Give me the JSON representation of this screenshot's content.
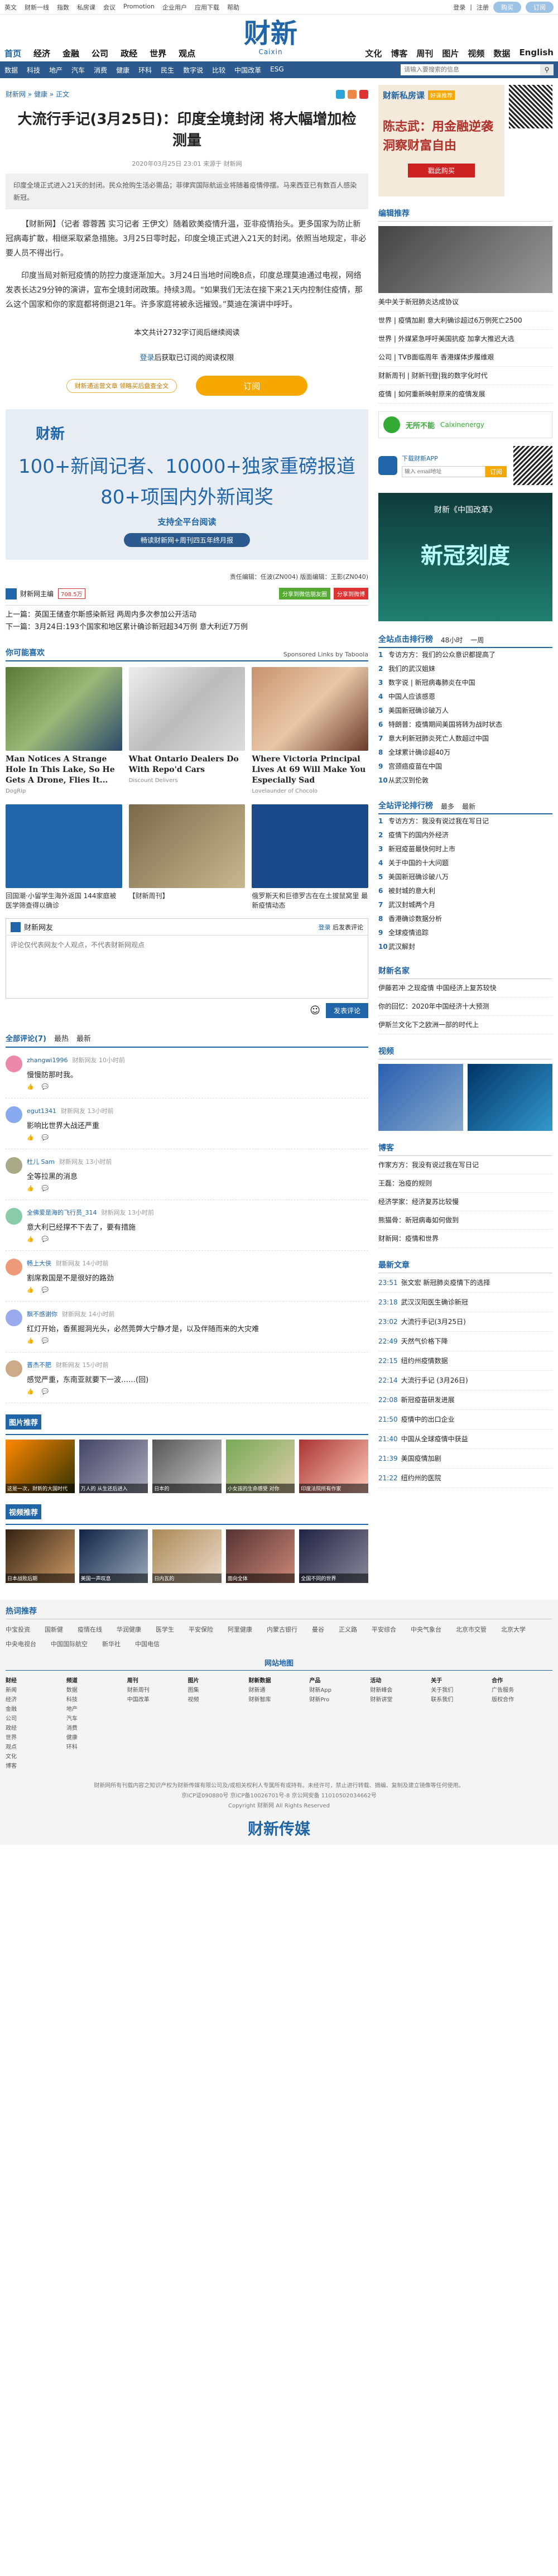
{
  "topbar": {
    "links": [
      "英文",
      "财新一线",
      "指数",
      "私房课",
      "会议",
      "Promotion",
      "企业用户",
      "应用下载",
      "帮助"
    ],
    "login": "登录",
    "register": "注册",
    "pill1": "购买",
    "pill2": "订阅"
  },
  "header": {
    "nav_left": [
      "首页",
      "经济",
      "金融",
      "公司",
      "政经",
      "世界",
      "观点"
    ],
    "logo_zh": "财新",
    "logo_en": "Caixin",
    "nav_right": [
      "文化",
      "博客",
      "周刊",
      "图片",
      "视频",
      "数据",
      "English"
    ]
  },
  "subnav": {
    "items": [
      "数据",
      "科技",
      "地产",
      "汽车",
      "消费",
      "健康",
      "环科",
      "民生",
      "数字说",
      "比较",
      "中国改革",
      "ESG"
    ],
    "search_placeholder": "请输入要搜索的信息"
  },
  "crumb": [
    "财新网",
    "健康",
    "正文"
  ],
  "article": {
    "title": "大流行手记(3月25日)：印度全境封闭 将大幅增加检测量",
    "meta": "2020年03月25日 23:01 来源于 财新网",
    "abstract": "印度全境正式进入21天的封闭。民众抢购生活必需品；菲律宾国际航运业将随着疫情停摆。马来西亚已有数百人感染新冠。",
    "p1": "【财新网】（记者 蓉蓉茜 实习记者 王伊文）随着欧美疫情升温，亚非疫情抬头。更多国家为防止新冠病毒扩散，相继采取紧急措施。3月25日零时起，印度全境正式进入21天的封闭。依照当地规定，非必要人员不得出行。",
    "p2": "印度当局对新冠疫情的防控力度逐渐加大。3月24日当地时间晚8点，印度总理莫迪通过电视，网络发表长达29分钟的演讲，宣布全境封闭政策。持续3周。“如果我们无法在接下来21天内控制住疫情，那么这个国家和你的家庭都将倒退21年。许多家庭将被永远摧毁。”莫迪在演讲中呼吁。",
    "count": "本文共计2732字订阅后继续阅读",
    "login_prefix": "登录",
    "login_suffix": "后获取已订阅的阅读权限",
    "pay_badge": "财新通运营文章 领略买后盘查全文",
    "pay_btn": "订阅",
    "promo": {
      "logo": "财新",
      "l1": "100+新闻记者、10000+独家重磅报道",
      "l2": "80+项国内外新闻奖",
      "l3": "支持全平台阅读",
      "l4": "畅读财新网+周刊四五年终月报"
    },
    "editors": "责任编辑：任波(ZN004) 版面编辑：王影(ZN040)",
    "tool_label": "财新网主编",
    "tool_chip": "708.5万",
    "rbtn1": "分享到微信朋友圈",
    "rbtn2": "分享到微博",
    "prev": "上一篇：英国王储查尔斯感染新冠 两周内多次参加公开活动",
    "next": "下一篇：3月24日:193个国家和地区累计确诊新冠超34万例 意大利近7万例"
  },
  "maybe": {
    "title": "你可能喜欢",
    "sponsor": "Sponsored Links by Taboola",
    "cards": [
      {
        "title": "Man Notices A Strange Hole In This Lake, So He Gets A Drone, Flies It...",
        "src": "DogRip"
      },
      {
        "title": "What Ontario Dealers Do With Repo'd Cars",
        "src": "Discount Delivers"
      },
      {
        "title": "Where Victoria Principal Lives At 69 Will Make You Especially Sad",
        "src": "Lovelaunder of Chocolo"
      }
    ],
    "cards2": [
      {
        "cap": "回国潮·小留学生海外返国 144家庭被医学筛查得以确诊"
      },
      {
        "cap": "【财新周刊】"
      },
      {
        "cap": "俄罗斯天和巨德罗古在在土拔鼠窝里 最新疫情动态"
      }
    ]
  },
  "comment": {
    "head": "财新网友",
    "login": "登录",
    "login2": "后发表评论",
    "placeholder": "评论仅代表网友个人观点，不代表财新网观点",
    "send": "发表评论",
    "tabs": [
      "全部评论(7)",
      "最热",
      "最新"
    ],
    "items": [
      {
        "user": "zhangwi1996",
        "time": "财新网友  10小时前",
        "text": "慢慢防那时我。"
      },
      {
        "user": "egut1341",
        "time": "财新网友  13小时前",
        "text": "影响比世界大战还严重"
      },
      {
        "user": "杜儿 Sam",
        "time": "财新网友  13小时前",
        "text": "全等拉黑的消息"
      },
      {
        "user": "全佛爱是海的飞行员_314",
        "time": "财新网友  13小时前",
        "text": "意大利已经撑不下去了，要有措施"
      },
      {
        "user": "畅上大侠",
        "time": "财新网友  14小时前",
        "text": "割席救国是不是很好的路劲"
      },
      {
        "user": "飘不感谢你",
        "time": "财新网友  14小时前",
        "text": "红灯开始，香蕉掘洞光头，必然莞弊大宁静才是，以及伴随而来的大灾难"
      },
      {
        "user": "晋杰不肥",
        "time": "财新网友  15小时前",
        "text": "感觉严重，东南亚就要下一波……(回)"
      }
    ]
  },
  "pics": {
    "title": "图片推荐",
    "items": [
      "这是一次，财新的大国时代",
      "万人的 从生还后进入",
      "日本的",
      "小女孩的生命感受 对你",
      "印度法院所有作家"
    ]
  },
  "videos": {
    "title": "视频推荐",
    "items": [
      "日本战败后期",
      "美国一声叹息",
      "日内瓦的",
      "面向全体",
      "全国不同的世界"
    ]
  },
  "side": {
    "ad1_title": "财新私房课",
    "ad1_btn": "好课推荐",
    "ad1_big": "陈志武：用金融逆袭洞察财富自由",
    "ad1_cta": "戳此购买",
    "hot_title": "编辑推荐",
    "hot_items": [
      "美中关于新冠肺炎达成协议",
      "世界 | 疫情加剧 意大利确诊超过6万例死亡2500",
      "世界 | 外媒紧急呼吁美国抗疫 加拿大推迟大选",
      "公司 | TVB面临周年 香港媒体步履维艰",
      "财新周刊 | 财新刊登|我的数字化时代",
      "疫情 | 如何重新映射原来的疫情发展"
    ],
    "reg_label": "无所不能",
    "reg_brand": "Caixinenergy",
    "app_label": "下载财新APP",
    "email_label": "输入 email地址",
    "email_btn": "订阅",
    "ad2_title": "财新《中国改革》",
    "ad2_big": "新冠刻度",
    "rank_title": "全站点击排行榜",
    "rank_tabs": [
      "48小时",
      "一周"
    ],
    "rank": [
      "专访方方：我们的公众意识都提高了",
      "我们的武汉姐妹",
      "数字说 | 新冠病毒肺炎在中国",
      "中国人应该感恩",
      "美国新冠确诊破万人",
      "特朗普：疫情期间美国将转为战时状态",
      "意大利新冠肺炎死亡人数超过中国",
      "全球累计确诊超40万",
      "宫颈癌疫苗在中国",
      "从武汉到伦敦"
    ],
    "cmt_title": "全站评论排行榜",
    "cmt_tabs": [
      "最多",
      "最新"
    ],
    "cmtrank": [
      "专访方方：我没有说过我在写日记",
      "疫情下的国内外经济",
      "新冠疫苗最快何时上市",
      "关于中国的十大问题",
      "美国新冠确诊破八万",
      "被封城的意大利",
      "武汉封城两个月",
      "香港确诊数据分析",
      "全球疫情追踪",
      "武汉解封"
    ],
    "caixin_title": "财新名家",
    "caixin_items": [
      "伊藤若冲 之现疫情 中国经济上复苏较快",
      "你的回忆：2020年中国经济十大预测",
      "伊斯兰文化下之欧洲一部的时代上"
    ],
    "video_title": "视频",
    "blog_title": "博客",
    "blog_items": [
      "作家方方：我没有说过我在写日记",
      "王磊：治疫的规则",
      "经济学家：经济复苏比较慢",
      "熊猫骨：新冠病毒如何做到",
      "财新网：疫情和世界"
    ],
    "news_title": "最新文章",
    "news": [
      {
        "t": "23:51",
        "s": "张文宏 新冠肺炎疫情下的选择"
      },
      {
        "t": "23:18",
        "s": "武汉汉阳医生确诊新冠"
      },
      {
        "t": "23:02",
        "s": "大流行手记(3月25日)"
      },
      {
        "t": "22:49",
        "s": "天然气价格下降"
      },
      {
        "t": "22:15",
        "s": "纽约州疫情数据"
      },
      {
        "t": "22:14",
        "s": "大流行手记 (3月26日)"
      },
      {
        "t": "22:08",
        "s": "新冠疫苗研发进展"
      },
      {
        "t": "21:50",
        "s": "疫情中的出口企业"
      },
      {
        "t": "21:40",
        "s": "中国从全球疫情中获益"
      },
      {
        "t": "21:39",
        "s": "美国疫情加剧"
      },
      {
        "t": "21:22",
        "s": "纽约州的医院"
      }
    ]
  },
  "footer": {
    "hot_title": "热词推荐",
    "hot": [
      "中宝投资",
      "国新健",
      "疫情在线",
      "华润健康",
      "医学生",
      "平安保险",
      "阿里健康",
      "内蒙古银行",
      "曼谷",
      "正义路",
      "平安综合",
      "中央气象台",
      "北京市交管",
      "北京大学",
      "中央电视台",
      "中国国际航空",
      "新华社",
      "中国电信"
    ],
    "map_title": "网站地图",
    "cols": [
      {
        "h": "财经",
        "items": [
          "新闻",
          "经济",
          "金融",
          "公司",
          "政经",
          "世界",
          "观点",
          "文化",
          "博客"
        ]
      },
      {
        "h": "频道",
        "items": [
          "数据",
          "科技",
          "地产",
          "汽车",
          "消费",
          "健康",
          "环科"
        ]
      },
      {
        "h": "周刊",
        "items": [
          "财新周刊",
          "中国改革"
        ]
      },
      {
        "h": "图片",
        "items": [
          "图集",
          "视频"
        ]
      },
      {
        "h": "财新数据",
        "items": [
          "财新通",
          "财新智库"
        ]
      },
      {
        "h": "产品",
        "items": [
          "财新App",
          "财新Pro"
        ]
      },
      {
        "h": "活动",
        "items": [
          "财新峰会",
          "财新讲堂"
        ]
      },
      {
        "h": "关于",
        "items": [
          "关于我们",
          "联系我们"
        ]
      },
      {
        "h": "合作",
        "items": [
          "广告服务",
          "版权合作"
        ]
      }
    ],
    "copy": [
      "财新网所有刊载内容之知识产权为财新传媒有限公司及/或相关权利人专属所有或持有。未经许可，禁止进行转载、摘编、复制及建立镜像等任何使用。",
      "京ICP证090880号 京ICP备10026701号-8 京公网安备 11010502034662号",
      "Copyright 财新网 All Rights Reserved"
    ],
    "btm_logo": "财新传媒"
  }
}
